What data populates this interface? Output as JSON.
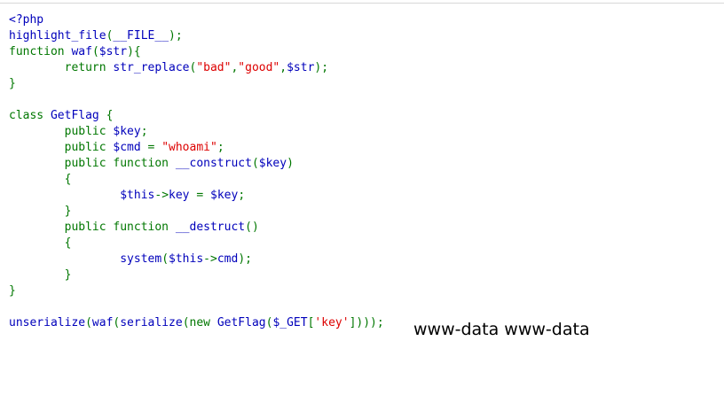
{
  "colors": {
    "default": "#0000bb",
    "keyword": "#007700",
    "string": "#dd0000",
    "html": "#000000"
  },
  "code_lines": [
    [
      {
        "t": "<?php",
        "c": "default"
      }
    ],
    [
      {
        "t": "highlight_file",
        "c": "default"
      },
      {
        "t": "(",
        "c": "keyword"
      },
      {
        "t": "__FILE__",
        "c": "default"
      },
      {
        "t": ");",
        "c": "keyword"
      }
    ],
    [
      {
        "t": "function ",
        "c": "keyword"
      },
      {
        "t": "waf",
        "c": "default"
      },
      {
        "t": "(",
        "c": "keyword"
      },
      {
        "t": "$str",
        "c": "default"
      },
      {
        "t": "){",
        "c": "keyword"
      }
    ],
    [
      {
        "t": "        return ",
        "c": "keyword"
      },
      {
        "t": "str_replace",
        "c": "default"
      },
      {
        "t": "(",
        "c": "keyword"
      },
      {
        "t": "\"bad\"",
        "c": "string"
      },
      {
        "t": ",",
        "c": "keyword"
      },
      {
        "t": "\"good\"",
        "c": "string"
      },
      {
        "t": ",",
        "c": "keyword"
      },
      {
        "t": "$str",
        "c": "default"
      },
      {
        "t": ");",
        "c": "keyword"
      }
    ],
    [
      {
        "t": "}",
        "c": "keyword"
      }
    ],
    [],
    [
      {
        "t": "class ",
        "c": "keyword"
      },
      {
        "t": "GetFlag ",
        "c": "default"
      },
      {
        "t": "{",
        "c": "keyword"
      }
    ],
    [
      {
        "t": "        public ",
        "c": "keyword"
      },
      {
        "t": "$key",
        "c": "default"
      },
      {
        "t": ";",
        "c": "keyword"
      }
    ],
    [
      {
        "t": "        public ",
        "c": "keyword"
      },
      {
        "t": "$cmd ",
        "c": "default"
      },
      {
        "t": "= ",
        "c": "keyword"
      },
      {
        "t": "\"whoami\"",
        "c": "string"
      },
      {
        "t": ";",
        "c": "keyword"
      }
    ],
    [
      {
        "t": "        public function ",
        "c": "keyword"
      },
      {
        "t": "__construct",
        "c": "default"
      },
      {
        "t": "(",
        "c": "keyword"
      },
      {
        "t": "$key",
        "c": "default"
      },
      {
        "t": ")",
        "c": "keyword"
      }
    ],
    [
      {
        "t": "        {",
        "c": "keyword"
      }
    ],
    [
      {
        "t": "                ",
        "c": "keyword"
      },
      {
        "t": "$this",
        "c": "default"
      },
      {
        "t": "->",
        "c": "keyword"
      },
      {
        "t": "key ",
        "c": "default"
      },
      {
        "t": "= ",
        "c": "keyword"
      },
      {
        "t": "$key",
        "c": "default"
      },
      {
        "t": ";",
        "c": "keyword"
      }
    ],
    [
      {
        "t": "        }",
        "c": "keyword"
      }
    ],
    [
      {
        "t": "        public function ",
        "c": "keyword"
      },
      {
        "t": "__destruct",
        "c": "default"
      },
      {
        "t": "()",
        "c": "keyword"
      }
    ],
    [
      {
        "t": "        {",
        "c": "keyword"
      }
    ],
    [
      {
        "t": "                ",
        "c": "keyword"
      },
      {
        "t": "system",
        "c": "default"
      },
      {
        "t": "(",
        "c": "keyword"
      },
      {
        "t": "$this",
        "c": "default"
      },
      {
        "t": "->",
        "c": "keyword"
      },
      {
        "t": "cmd",
        "c": "default"
      },
      {
        "t": ");",
        "c": "keyword"
      }
    ],
    [
      {
        "t": "        }",
        "c": "keyword"
      }
    ],
    [
      {
        "t": "}",
        "c": "keyword"
      }
    ],
    [],
    [
      {
        "t": "unserialize",
        "c": "default"
      },
      {
        "t": "(",
        "c": "keyword"
      },
      {
        "t": "waf",
        "c": "default"
      },
      {
        "t": "(",
        "c": "keyword"
      },
      {
        "t": "serialize",
        "c": "default"
      },
      {
        "t": "(new ",
        "c": "keyword"
      },
      {
        "t": "GetFlag",
        "c": "default"
      },
      {
        "t": "(",
        "c": "keyword"
      },
      {
        "t": "$_GET",
        "c": "default"
      },
      {
        "t": "[",
        "c": "keyword"
      },
      {
        "t": "'key'",
        "c": "string"
      },
      {
        "t": "])));",
        "c": "keyword"
      }
    ]
  ],
  "output_text": "www-data www-data"
}
